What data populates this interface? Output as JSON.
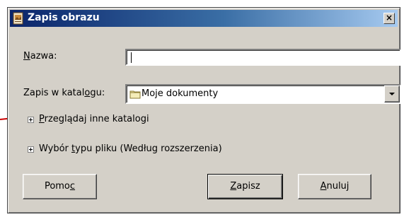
{
  "dialog": {
    "title": "Zapis obrazu",
    "close_label": "×"
  },
  "form": {
    "name_label_prefix": "N",
    "name_label_rest": "azwa:",
    "name_value": "",
    "folder_label_prefix": "Zapis w katal",
    "folder_label_mnemonic": "o",
    "folder_label_suffix": "gu:",
    "folder_value": "Moje dokumenty"
  },
  "expanders": {
    "browse_mnemonic": "P",
    "browse_rest": "rzeglądaj inne katalogi",
    "filetype_prefix": "Wybór ",
    "filetype_mnemonic": "t",
    "filetype_rest": "ypu pliku (Według rozszerzenia)"
  },
  "buttons": {
    "help_prefix": "Pomo",
    "help_mnemonic": "c",
    "save_mnemonic": "Z",
    "save_rest": "apisz",
    "cancel_mnemonic": "A",
    "cancel_rest": "nuluj"
  },
  "colors": {
    "annotation_arrow": "#cc0000",
    "title_bar_start": "#0a246a",
    "dialog_face": "#d4d0c8"
  }
}
